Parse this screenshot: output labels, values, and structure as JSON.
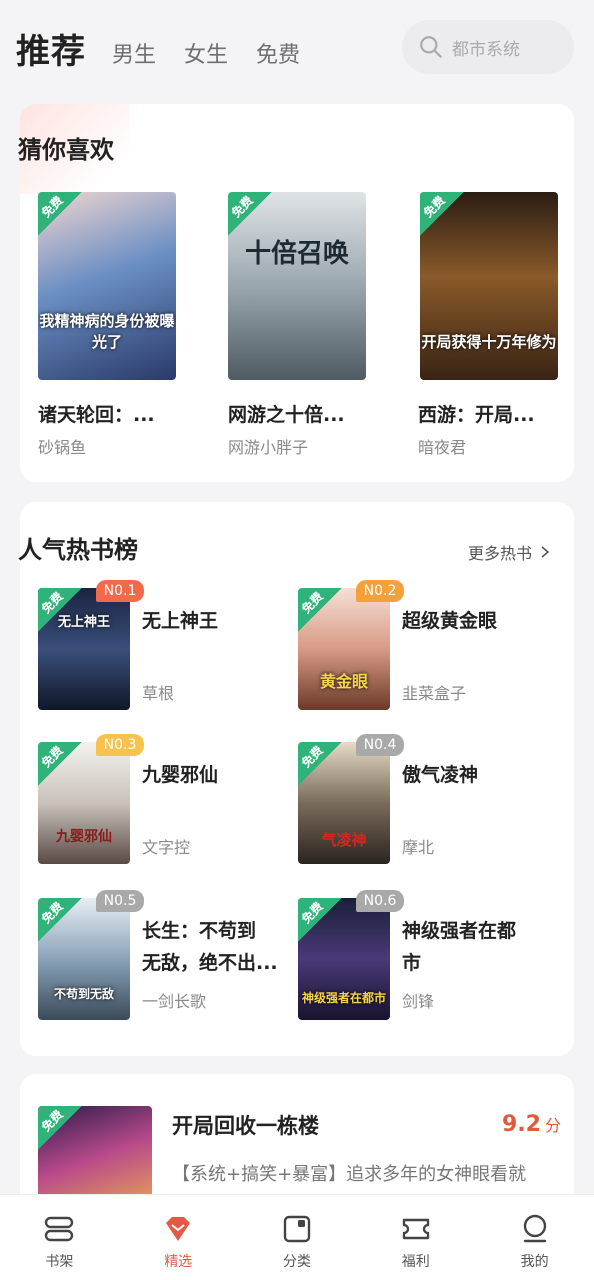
{
  "header": {
    "tabs": [
      {
        "label": "推荐",
        "active": true
      },
      {
        "label": "男生"
      },
      {
        "label": "女生"
      },
      {
        "label": "免费"
      }
    ],
    "search_placeholder": "都市系统"
  },
  "guess": {
    "title": "猜你喜欢",
    "free_tag": "免费",
    "books": [
      {
        "name": "诸天轮回：...",
        "author": "砂锅鱼",
        "cover_text": "我精神病的身份被曝光了"
      },
      {
        "name": "网游之十倍...",
        "author": "网游小胖子",
        "cover_text": "十倍召唤"
      },
      {
        "name": "西游：开局...",
        "author": "暗夜君",
        "cover_text": "开局获得十万年修为"
      }
    ]
  },
  "rank": {
    "title": "人气热书榜",
    "more": "更多热书",
    "books": [
      {
        "rank": "N0.1",
        "name": "无上神王",
        "author": "草根",
        "cover_text": "无上神王"
      },
      {
        "rank": "N0.2",
        "name": "超级黄金眼",
        "author": "韭菜盒子",
        "cover_text": "黄金眼"
      },
      {
        "rank": "N0.3",
        "name": "九婴邪仙",
        "author": "文字控",
        "cover_text": "九婴邪仙"
      },
      {
        "rank": "N0.4",
        "name": "傲气凌神",
        "author": "摩北",
        "cover_text": "气凌神"
      },
      {
        "rank": "N0.5",
        "name": "长生：不苟到",
        "name2": "无敌，绝不出...",
        "author": "一剑长歌",
        "cover_text": "不苟到无敌"
      },
      {
        "rank": "N0.6",
        "name": "神级强者在都",
        "name2": "市",
        "author": "剑锋",
        "cover_text": "神级强者在都市"
      }
    ]
  },
  "featured": {
    "name": "开局回收一栋楼",
    "score": "9.2",
    "score_unit": "分",
    "desc": "【系统+搞笑+暴富】追求多年的女神眼看就"
  },
  "nav": [
    {
      "label": "书架",
      "icon": "bookshelf-icon"
    },
    {
      "label": "精选",
      "icon": "diamond-icon",
      "active": true
    },
    {
      "label": "分类",
      "icon": "category-icon"
    },
    {
      "label": "福利",
      "icon": "ticket-icon"
    },
    {
      "label": "我的",
      "icon": "profile-icon"
    }
  ],
  "colors": {
    "accent": "#e25a45",
    "free_green": "#2fb37a",
    "rank1": "#f26a4b",
    "rank2": "#f5a13a",
    "rank3": "#f7c24e",
    "rank_other": "#a9a9a9"
  }
}
